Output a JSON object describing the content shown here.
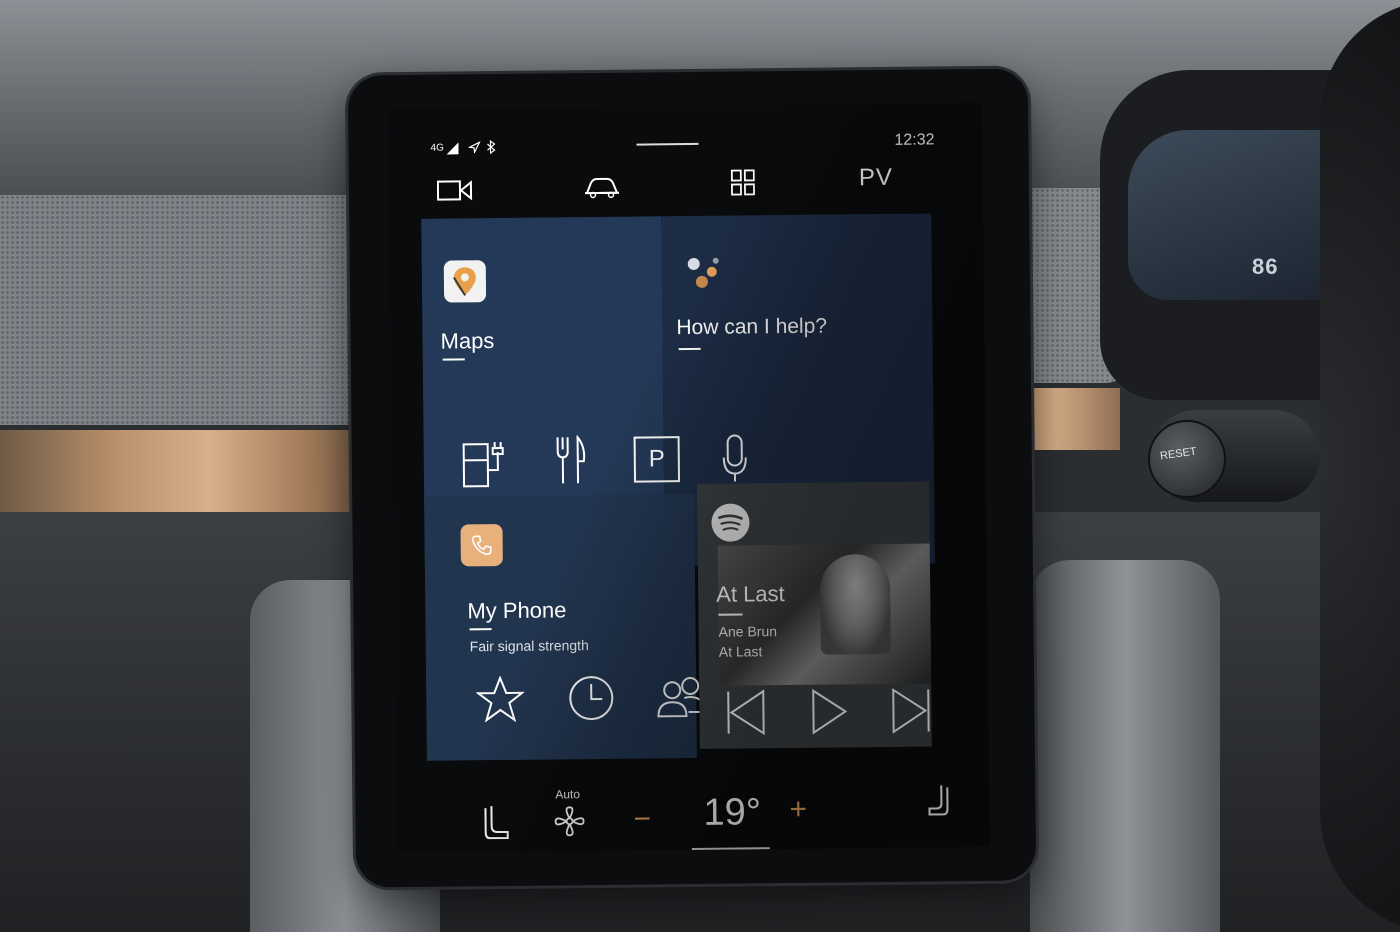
{
  "status": {
    "network": "4G",
    "time": "12:32"
  },
  "nav": {
    "profile": "PV"
  },
  "maps": {
    "title": "Maps"
  },
  "assistant": {
    "prompt": "How can I help?"
  },
  "quick_actions": [
    "charging-station-icon",
    "restaurant-icon",
    "parking-icon",
    "microphone-icon"
  ],
  "parking": {
    "letter": "P"
  },
  "phone": {
    "title": "My Phone",
    "signal": "Fair signal strength"
  },
  "spotify": {
    "title": "At Last",
    "artist": "Ane Brun",
    "album": "At Last"
  },
  "climate": {
    "fan_mode": "Auto",
    "temperature": "19°",
    "minus": "−",
    "plus": "+"
  },
  "cluster": {
    "readout": "86"
  },
  "stalk": {
    "reset_label": "RESET"
  },
  "colors": {
    "accent": "#e5a15a",
    "maps_card": "#243957",
    "assist_card": "#1d2d46",
    "phone_card": "#22354f",
    "spotify_card": "#3b4044"
  }
}
